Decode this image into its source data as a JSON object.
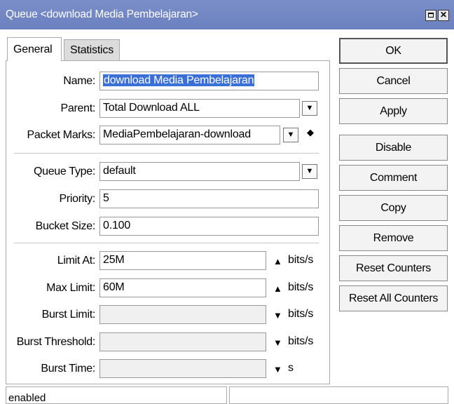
{
  "window": {
    "title": "Queue <download Media Pembelajaran>",
    "maximize_icon": "maximize-icon",
    "close_icon": "close-icon",
    "close_glyph": "✕"
  },
  "tabs": [
    {
      "label": "General",
      "active": true
    },
    {
      "label": "Statistics",
      "active": false
    }
  ],
  "form": {
    "name": {
      "label": "Name:",
      "value": "download Media Pembelajaran"
    },
    "parent": {
      "label": "Parent:",
      "value": "Total Download ALL"
    },
    "packet_marks": {
      "label": "Packet Marks:",
      "value": "MediaPembelajaran-download"
    },
    "queue_type": {
      "label": "Queue Type:",
      "value": "default"
    },
    "priority": {
      "label": "Priority:",
      "value": "5"
    },
    "bucket_size": {
      "label": "Bucket Size:",
      "value": "0.100"
    },
    "limit_at": {
      "label": "Limit At:",
      "value": "25M",
      "unit": "bits/s"
    },
    "max_limit": {
      "label": "Max Limit:",
      "value": "60M",
      "unit": "bits/s"
    },
    "burst_limit": {
      "label": "Burst Limit:",
      "value": "",
      "unit": "bits/s"
    },
    "burst_threshold": {
      "label": "Burst Threshold:",
      "value": "",
      "unit": "bits/s"
    },
    "burst_time": {
      "label": "Burst Time:",
      "value": "",
      "unit": "s"
    }
  },
  "glyphs": {
    "dropdown": "▼",
    "up": "▲",
    "down": "▼",
    "updown": "◆"
  },
  "buttons": {
    "ok": "OK",
    "cancel": "Cancel",
    "apply": "Apply",
    "disable": "Disable",
    "comment": "Comment",
    "copy": "Copy",
    "remove": "Remove",
    "reset_counters": "Reset Counters",
    "reset_all_counters": "Reset All Counters"
  },
  "status": {
    "state": "enabled",
    "extra": ""
  },
  "colors": {
    "titlebar": "#7085c4",
    "selection": "#3a6fd8"
  }
}
